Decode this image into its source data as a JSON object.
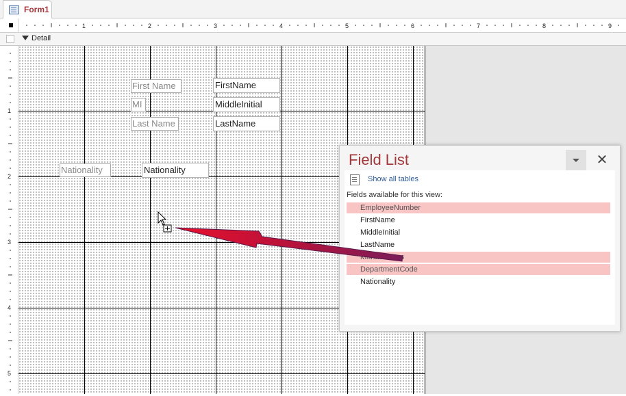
{
  "tab": {
    "label": "Form1",
    "icon": "form-icon"
  },
  "section": {
    "label": "Detail"
  },
  "ruler": {
    "h_marks": [
      "1",
      "2",
      "3",
      "4",
      "5",
      "6",
      "7",
      "8",
      "9"
    ],
    "v_marks": [
      "1",
      "2",
      "3",
      "4",
      "5"
    ]
  },
  "controls": {
    "label_first_name": "First Name",
    "text_first_name": "FirstName",
    "label_mi": "MI",
    "text_middle_initial": "MiddleInitial",
    "label_last_name": "Last Name",
    "text_last_name": "LastName",
    "label_nationality": "Nationality",
    "text_nationality": "Nationality"
  },
  "field_list": {
    "title": "Field List",
    "show_all_tables": "Show all tables",
    "available_label": "Fields available for this view:",
    "fields": [
      {
        "name": "EmployeeNumber",
        "selected": true
      },
      {
        "name": "FirstName",
        "selected": false
      },
      {
        "name": "MiddleInitial",
        "selected": false
      },
      {
        "name": "LastName",
        "selected": false
      },
      {
        "name": "MaritalStatus",
        "selected": true
      },
      {
        "name": "DepartmentCode",
        "selected": true
      },
      {
        "name": "Nationality",
        "selected": false
      }
    ]
  },
  "colors": {
    "accent": "#a4373a",
    "selection": "#f9c4c4",
    "link": "#2e5c99",
    "arrow": "#c0102a"
  }
}
